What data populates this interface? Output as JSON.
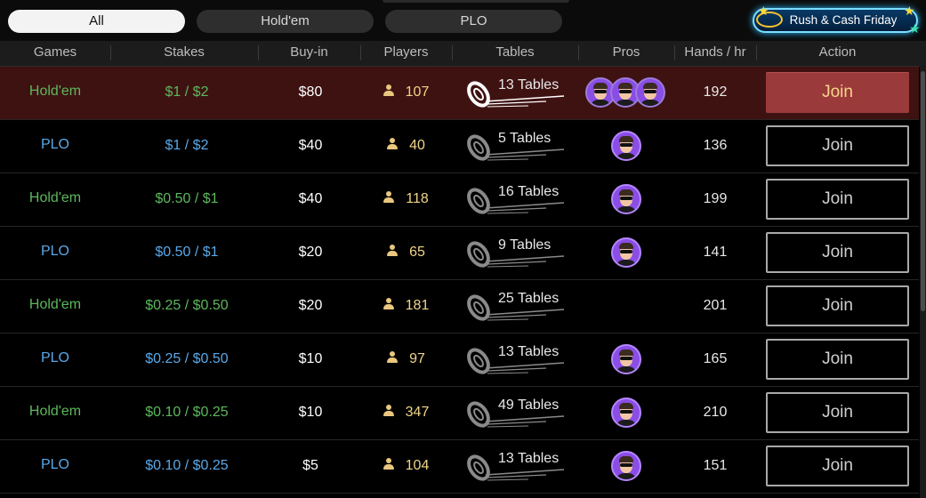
{
  "filters": [
    {
      "label": "All",
      "active": true
    },
    {
      "label": "Hold'em",
      "active": false
    },
    {
      "label": "PLO",
      "active": false
    }
  ],
  "promo": {
    "label": "Rush & Cash Friday"
  },
  "header": {
    "games": "Games",
    "stakes": "Stakes",
    "buyin": "Buy-in",
    "players": "Players",
    "tables": "Tables",
    "pros": "Pros",
    "hands": "Hands / hr",
    "action": "Action"
  },
  "rows": [
    {
      "game": "Hold'em",
      "stakes": "$1 / $2",
      "buyin": "$80",
      "players": "107",
      "tables": "13 Tables",
      "pros": 3,
      "hands": "192",
      "action": "Join",
      "highlight": true
    },
    {
      "game": "PLO",
      "stakes": "$1 / $2",
      "buyin": "$40",
      "players": "40",
      "tables": "5 Tables",
      "pros": 1,
      "hands": "136",
      "action": "Join",
      "highlight": false
    },
    {
      "game": "Hold'em",
      "stakes": "$0.50 / $1",
      "buyin": "$40",
      "players": "118",
      "tables": "16 Tables",
      "pros": 1,
      "hands": "199",
      "action": "Join",
      "highlight": false
    },
    {
      "game": "PLO",
      "stakes": "$0.50 / $1",
      "buyin": "$20",
      "players": "65",
      "tables": "9 Tables",
      "pros": 1,
      "hands": "141",
      "action": "Join",
      "highlight": false
    },
    {
      "game": "Hold'em",
      "stakes": "$0.25 / $0.50",
      "buyin": "$20",
      "players": "181",
      "tables": "25 Tables",
      "pros": 0,
      "hands": "201",
      "action": "Join",
      "highlight": false
    },
    {
      "game": "PLO",
      "stakes": "$0.25 / $0.50",
      "buyin": "$10",
      "players": "97",
      "tables": "13 Tables",
      "pros": 1,
      "hands": "165",
      "action": "Join",
      "highlight": false
    },
    {
      "game": "Hold'em",
      "stakes": "$0.10 / $0.25",
      "buyin": "$10",
      "players": "347",
      "tables": "49 Tables",
      "pros": 1,
      "hands": "210",
      "action": "Join",
      "highlight": false
    },
    {
      "game": "PLO",
      "stakes": "$0.10 / $0.25",
      "buyin": "$5",
      "players": "104",
      "tables": "13 Tables",
      "pros": 1,
      "hands": "151",
      "action": "Join",
      "highlight": false
    }
  ],
  "colors": {
    "holdem": "#5cb85c",
    "plo": "#5aa8e8",
    "highlight_row": "#3f1212",
    "join_primary": "#9b3a3a"
  },
  "icons": [
    "person-icon",
    "tables-chip-icon",
    "pro-avatar-icon",
    "star-icon"
  ]
}
